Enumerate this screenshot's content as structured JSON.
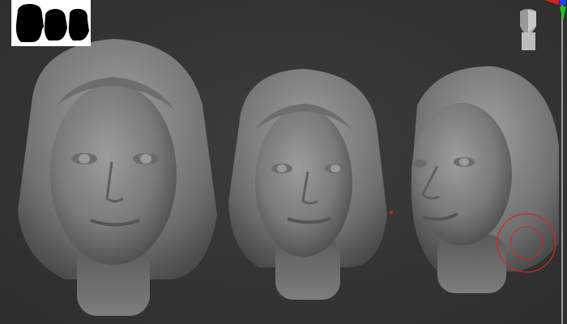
{
  "viewport": {
    "background_color": "#353535",
    "model_color": "#8a8a8a",
    "brush_cursor_color": "#d02828",
    "models": [
      {
        "name": "head-front-view"
      },
      {
        "name": "head-front-view-smaller"
      },
      {
        "name": "head-three-quarter-view"
      }
    ]
  },
  "navigator": {
    "icon": "silhouette-thumbnail-icon"
  },
  "gizmo": {
    "axis_colors": {
      "x": "#e02020",
      "y": "#20c020",
      "z": "#2040e0"
    },
    "icon": "orientation-head-icon"
  }
}
